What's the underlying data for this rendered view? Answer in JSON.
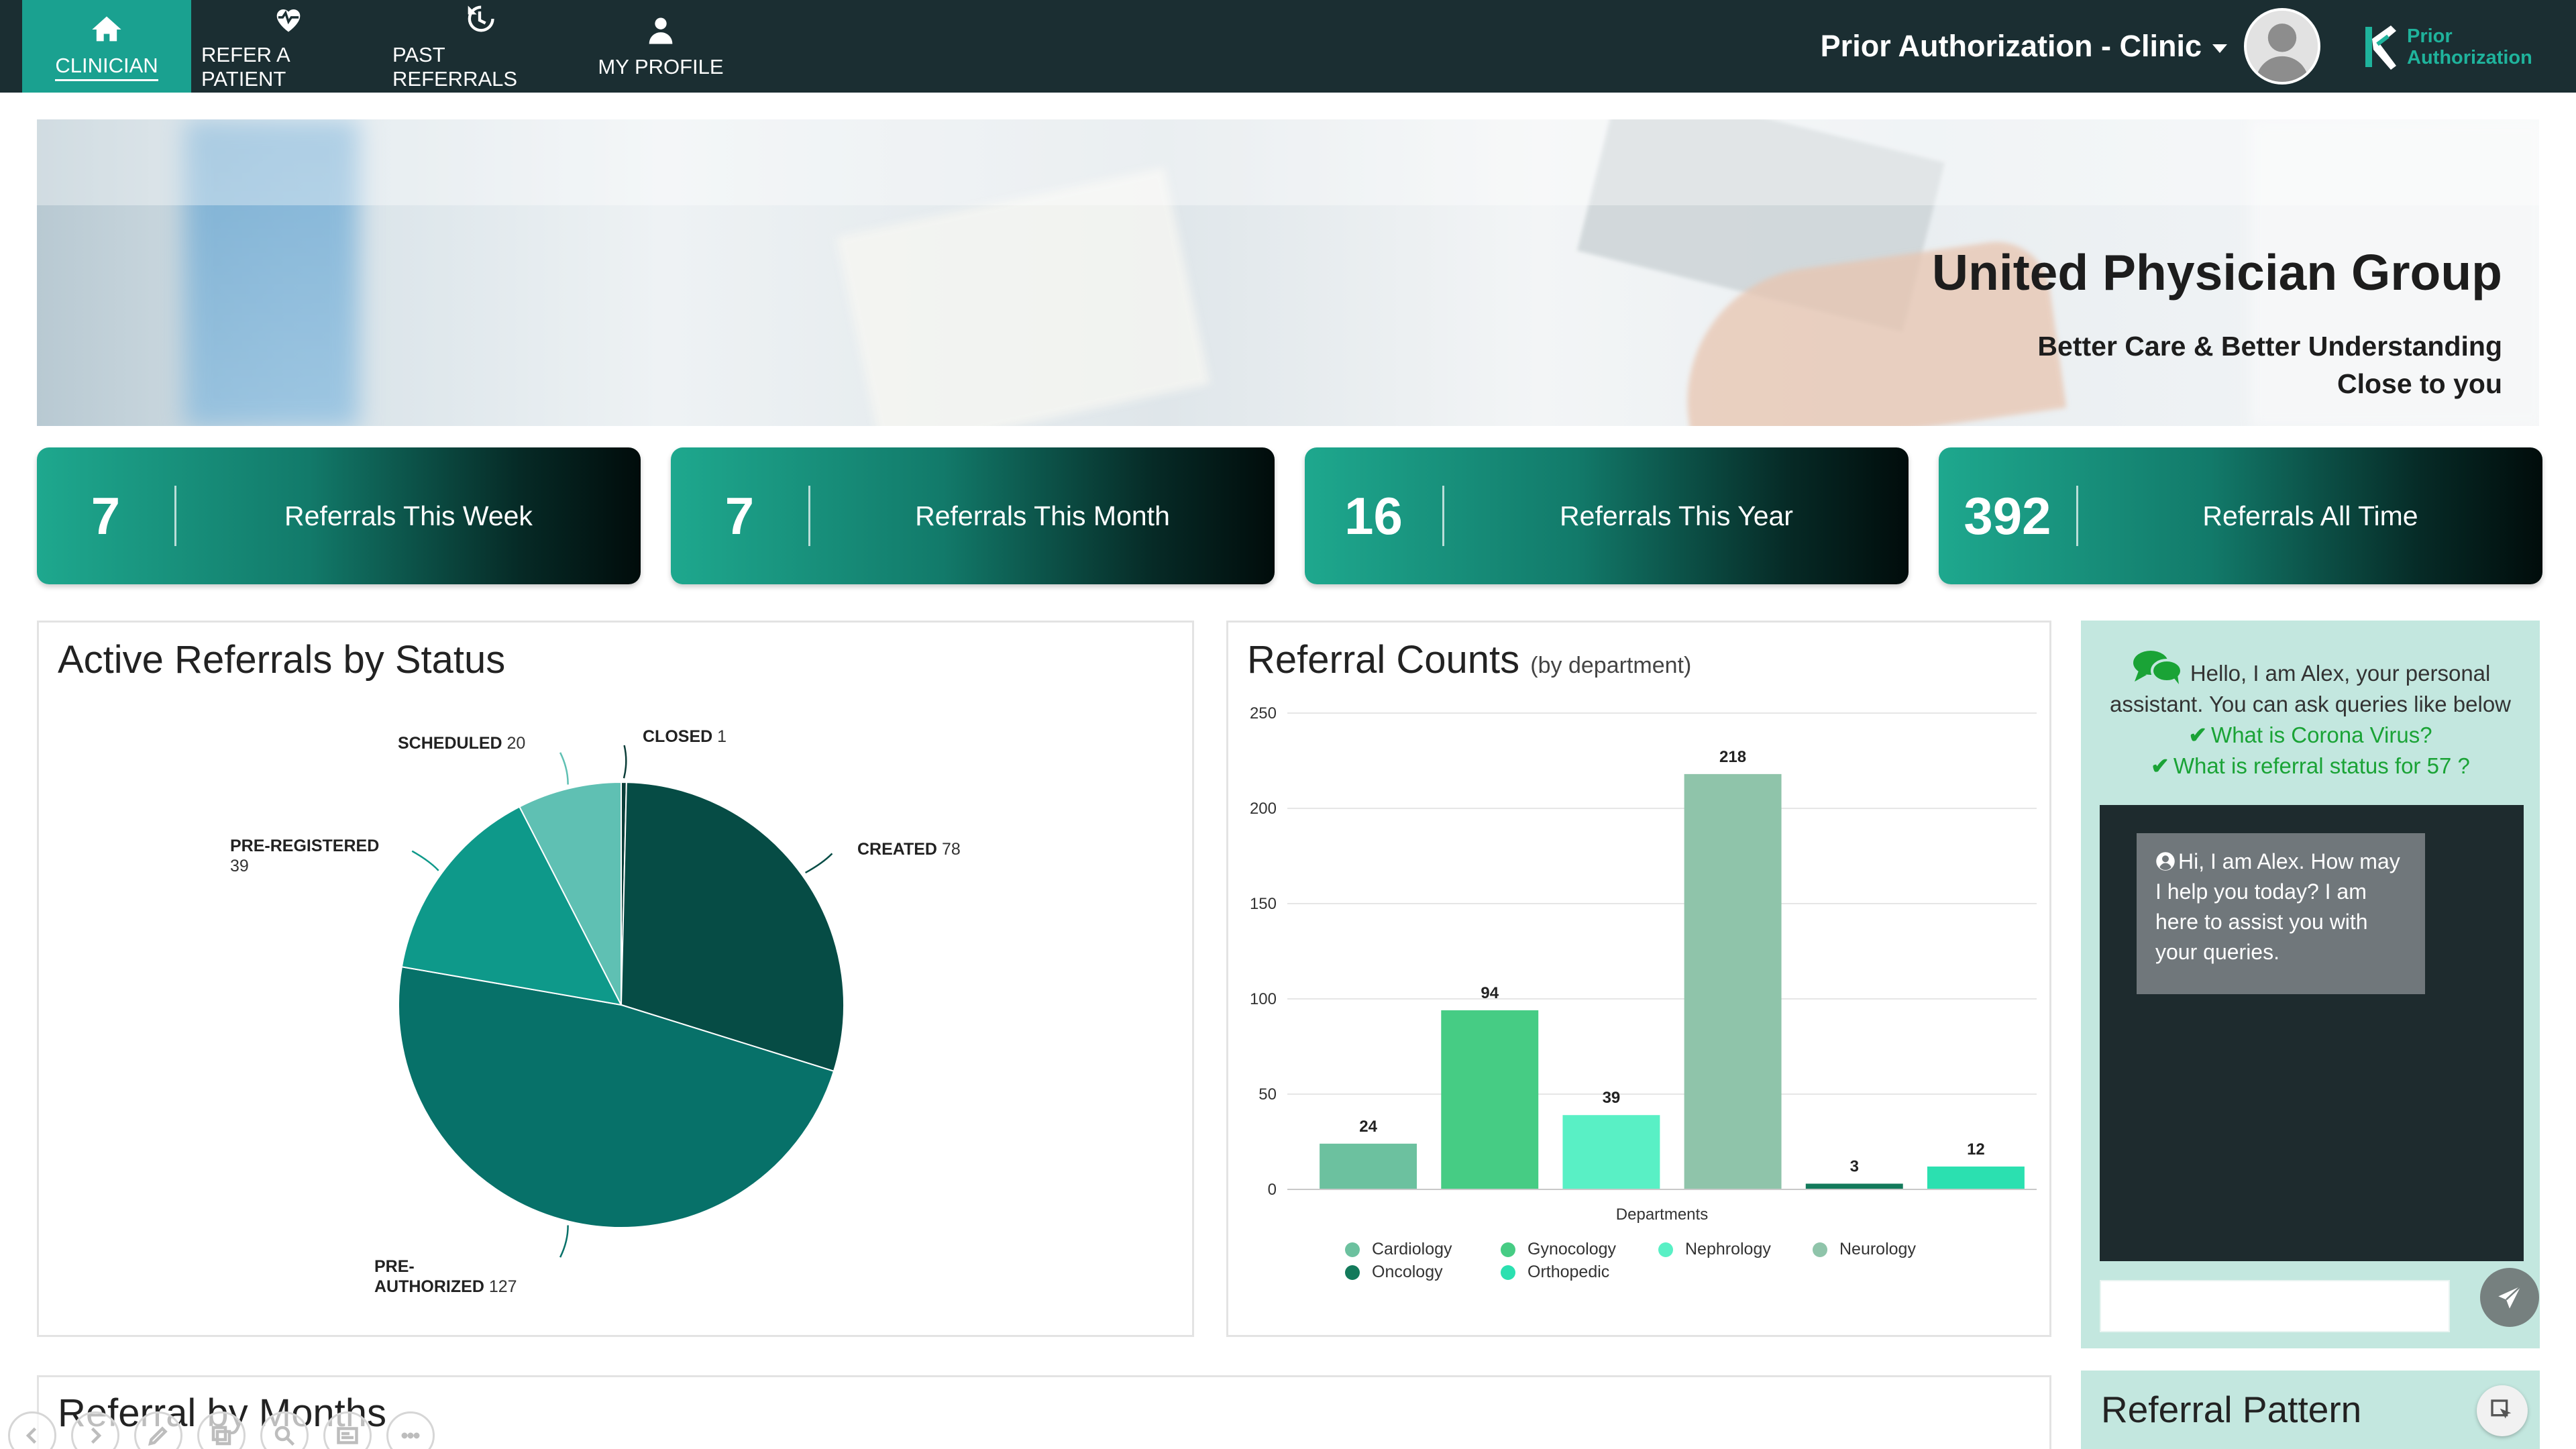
{
  "nav": {
    "items": [
      {
        "label": "CLINICIAN",
        "icon": "home-icon",
        "active": true
      },
      {
        "label": "REFER A PATIENT",
        "icon": "heart-pulse-icon",
        "active": false
      },
      {
        "label": "PAST REFERRALS",
        "icon": "history-icon",
        "active": false
      },
      {
        "label": "MY PROFILE",
        "icon": "user-profile-icon",
        "active": false
      }
    ],
    "clinic_title": "Prior Authorization - Clinic",
    "logo_line1": "Prior",
    "logo_line2": "Authorization"
  },
  "banner": {
    "title": "United Physician Group",
    "subtitle_line1": "Better Care & Better Understanding",
    "subtitle_line2": "Close to you"
  },
  "stats": [
    {
      "value": "7",
      "label": "Referrals This Week"
    },
    {
      "value": "7",
      "label": "Referrals This Month"
    },
    {
      "value": "16",
      "label": "Referrals This Year"
    },
    {
      "value": "392",
      "label": "Referrals All Time"
    }
  ],
  "status_panel": {
    "title": "Active Referrals by Status"
  },
  "dept_panel": {
    "title": "Referral Counts",
    "title_suffix": "(by department)"
  },
  "months_panel": {
    "title": "Referral by Months"
  },
  "pattern_panel": {
    "title": "Referral Pattern"
  },
  "chart_data": [
    {
      "type": "pie",
      "title": "Active Referrals by Status",
      "slices": [
        {
          "label": "CLOSED",
          "value": 1,
          "color": "#0a3d38"
        },
        {
          "label": "CREATED",
          "value": 78,
          "color": "#064c45"
        },
        {
          "label": "PRE-AUTHORIZED",
          "value": 127,
          "color": "#077169"
        },
        {
          "label": "PRE-REGISTERED",
          "value": 39,
          "color": "#0e998a"
        },
        {
          "label": "SCHEDULED",
          "value": 20,
          "color": "#5fc0b3"
        }
      ]
    },
    {
      "type": "bar",
      "title": "Referral Counts",
      "xlabel": "Departments",
      "ylabel": "",
      "ylim": [
        0,
        250
      ],
      "yticks": [
        0,
        50,
        100,
        150,
        200,
        250
      ],
      "categories": [
        "Cardiology",
        "Gynocology",
        "Nephrology",
        "Neurology",
        "Oncology",
        "Orthopedic"
      ],
      "values": [
        24,
        94,
        39,
        218,
        3,
        12
      ],
      "colors": [
        "#6cc19f",
        "#46cc84",
        "#59f0c5",
        "#8fc4aa",
        "#137a5b",
        "#2be0b0"
      ]
    }
  ],
  "chat": {
    "greeting": "Hello,  I am Alex, your personal assistant. You can ask queries like below",
    "examples": [
      "What is Corona Virus?",
      "What is referral status for 57 ?"
    ],
    "bot_message": "Hi, I am Alex. How may I help you today? I am here to assist you with your queries.",
    "input_placeholder": ""
  }
}
